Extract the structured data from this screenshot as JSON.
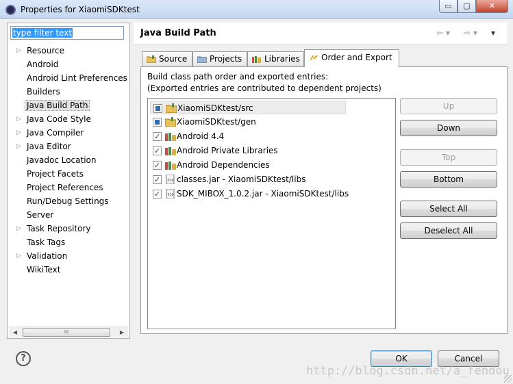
{
  "window": {
    "title": "Properties for XiaomiSDKtest",
    "min_label": "▭",
    "max_label": "▢",
    "close_label": "✕"
  },
  "filter": {
    "value": "type filter text"
  },
  "tree": {
    "items": [
      {
        "label": "Resource",
        "expandable": true
      },
      {
        "label": "Android",
        "expandable": false
      },
      {
        "label": "Android Lint Preferences",
        "expandable": false
      },
      {
        "label": "Builders",
        "expandable": false
      },
      {
        "label": "Java Build Path",
        "expandable": false,
        "selected": true
      },
      {
        "label": "Java Code Style",
        "expandable": true
      },
      {
        "label": "Java Compiler",
        "expandable": true
      },
      {
        "label": "Java Editor",
        "expandable": true
      },
      {
        "label": "Javadoc Location",
        "expandable": false
      },
      {
        "label": "Project Facets",
        "expandable": false
      },
      {
        "label": "Project References",
        "expandable": false
      },
      {
        "label": "Run/Debug Settings",
        "expandable": false
      },
      {
        "label": "Server",
        "expandable": false
      },
      {
        "label": "Task Repository",
        "expandable": true
      },
      {
        "label": "Task Tags",
        "expandable": false
      },
      {
        "label": "Validation",
        "expandable": true
      },
      {
        "label": "WikiText",
        "expandable": false
      }
    ],
    "scroll_thumb_label": "III"
  },
  "page": {
    "title": "Java Build Path",
    "nav_back": "⇦ ▾",
    "nav_fwd": "⇨ ▾",
    "menu": "▾"
  },
  "tabs": [
    {
      "label": "Source",
      "icon": "source-folder-icon"
    },
    {
      "label": "Projects",
      "icon": "projects-icon"
    },
    {
      "label": "Libraries",
      "icon": "libraries-icon"
    },
    {
      "label": "Order and Export",
      "icon": "order-export-icon",
      "active": true
    }
  ],
  "description": {
    "line1": "Build class path order and exported entries:",
    "line2": "(Exported entries are contributed to dependent projects)"
  },
  "entries": [
    {
      "label": "XiaomiSDKtest/src",
      "check": "partial",
      "icon": "source-folder-icon",
      "selected": true
    },
    {
      "label": "XiaomiSDKtest/gen",
      "check": "partial",
      "icon": "source-folder-icon"
    },
    {
      "label": "Android 4.4",
      "check": "checked",
      "icon": "library-icon"
    },
    {
      "label": "Android Private Libraries",
      "check": "checked",
      "icon": "library-icon"
    },
    {
      "label": "Android Dependencies",
      "check": "checked",
      "icon": "library-icon"
    },
    {
      "label": "classes.jar - XiaomiSDKtest/libs",
      "check": "checked",
      "icon": "jar-icon"
    },
    {
      "label": "SDK_MIBOX_1.0.2.jar - XiaomiSDKtest/libs",
      "check": "checked",
      "icon": "jar-icon"
    }
  ],
  "buttons": {
    "up": "Up",
    "down": "Down",
    "top": "Top",
    "bottom": "Bottom",
    "select_all": "Select All",
    "deselect_all": "Deselect All"
  },
  "dialog": {
    "help": "?",
    "ok": "OK",
    "cancel": "Cancel"
  },
  "watermark": "http://blog.csdn.net/a_fendou"
}
